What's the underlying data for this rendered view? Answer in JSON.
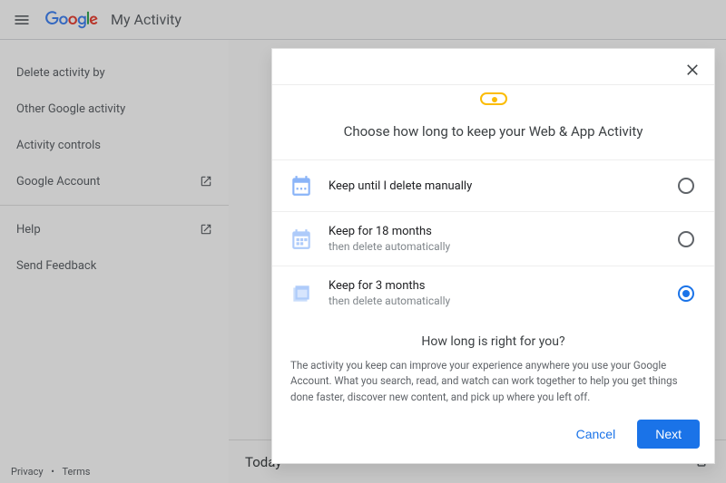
{
  "header": {
    "product": "My Activity"
  },
  "sidebar": {
    "items": [
      {
        "label": "Delete activity by",
        "external": false
      },
      {
        "label": "Other Google activity",
        "external": false
      },
      {
        "label": "Activity controls",
        "external": false
      },
      {
        "label": "Google Account",
        "external": true
      },
      {
        "label": "Help",
        "external": true
      },
      {
        "label": "Send Feedback",
        "external": false
      }
    ]
  },
  "content": {
    "today_header": "Today"
  },
  "footer": {
    "privacy": "Privacy",
    "terms": "Terms"
  },
  "dialog": {
    "title": "Choose how long to keep your Web & App Activity",
    "options": [
      {
        "title": "Keep until I delete manually",
        "sub": "",
        "selected": false
      },
      {
        "title": "Keep for 18 months",
        "sub": "then delete automatically",
        "selected": false
      },
      {
        "title": "Keep for 3 months",
        "sub": "then delete automatically",
        "selected": true
      }
    ],
    "info_title": "How long is right for you?",
    "info_body": "The activity you keep can improve your experience anywhere you use your Google Account. What you search, read, and watch can work together to help you get things done faster, discover new content, and pick up where you left off.",
    "cancel_label": "Cancel",
    "next_label": "Next"
  }
}
